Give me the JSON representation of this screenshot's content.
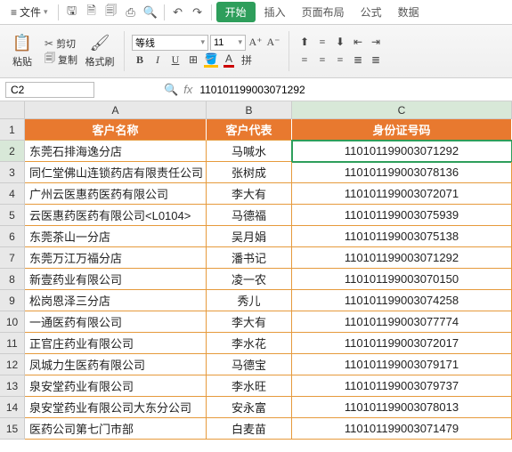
{
  "menubar": {
    "file_label": "文件",
    "start_label": "开始",
    "insert_label": "插入",
    "layout_label": "页面布局",
    "formula_label": "公式",
    "data_label": "数据"
  },
  "ribbon": {
    "paste_label": "粘贴",
    "cut_label": "剪切",
    "copy_label": "复制",
    "format_painter_label": "格式刷",
    "font_name": "等线",
    "font_size": "11"
  },
  "formula_bar": {
    "name_box": "C2",
    "fx_label": "fx",
    "value": "110101199003071292"
  },
  "headers": {
    "A": "A",
    "B": "B",
    "C": "C"
  },
  "table_headers": {
    "A": "客户名称",
    "B": "客户代表",
    "C": "身份证号码"
  },
  "rows": [
    {
      "n": "2",
      "A": "东莞石排海逸分店",
      "B": "马喊水",
      "C": "110101199003071292",
      "selected": true
    },
    {
      "n": "3",
      "A": "同仁堂佛山连锁药店有限责任公司",
      "B": "张树成",
      "C": "110101199003078136"
    },
    {
      "n": "4",
      "A": "广州云医惠药医药有限公司",
      "B": "李大有",
      "C": "110101199003072071"
    },
    {
      "n": "5",
      "A": "云医惠药医药有限公司<L0104>",
      "B": "马德福",
      "C": "110101199003075939"
    },
    {
      "n": "6",
      "A": "东莞茶山一分店",
      "B": "吴月娟",
      "C": "110101199003075138"
    },
    {
      "n": "7",
      "A": "东莞万江万福分店",
      "B": "潘书记",
      "C": "110101199003071292"
    },
    {
      "n": "8",
      "A": "新壹药业有限公司",
      "B": "凌一农",
      "C": "110101199003070150"
    },
    {
      "n": "9",
      "A": "松岗恩泽三分店",
      "B": "秀儿",
      "C": "110101199003074258"
    },
    {
      "n": "10",
      "A": "一通医药有限公司",
      "B": "李大有",
      "C": "110101199003077774"
    },
    {
      "n": "11",
      "A": "正官庄药业有限公司",
      "B": "李水花",
      "C": "110101199003072017"
    },
    {
      "n": "12",
      "A": "凤城力生医药有限公司",
      "B": "马德宝",
      "C": "110101199003079171"
    },
    {
      "n": "13",
      "A": "泉安堂药业有限公司",
      "B": "李水旺",
      "C": "110101199003079737"
    },
    {
      "n": "14",
      "A": "泉安堂药业有限公司大东分公司",
      "B": "安永富",
      "C": "110101199003078013"
    },
    {
      "n": "15",
      "A": "医药公司第七门市部",
      "B": "白麦苗",
      "C": "110101199003071479"
    }
  ]
}
